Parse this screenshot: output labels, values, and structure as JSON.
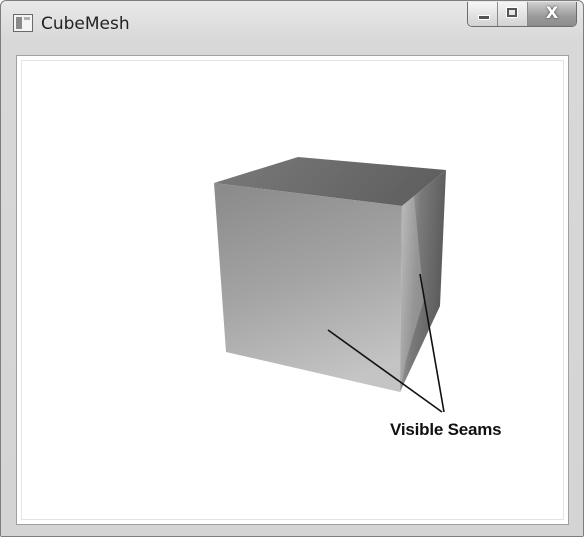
{
  "window": {
    "title": "CubeMesh",
    "controls": {
      "minimize": "minimize",
      "maximize": "maximize",
      "close_label": "X"
    }
  },
  "scene": {
    "annotation": "Visible Seams"
  }
}
